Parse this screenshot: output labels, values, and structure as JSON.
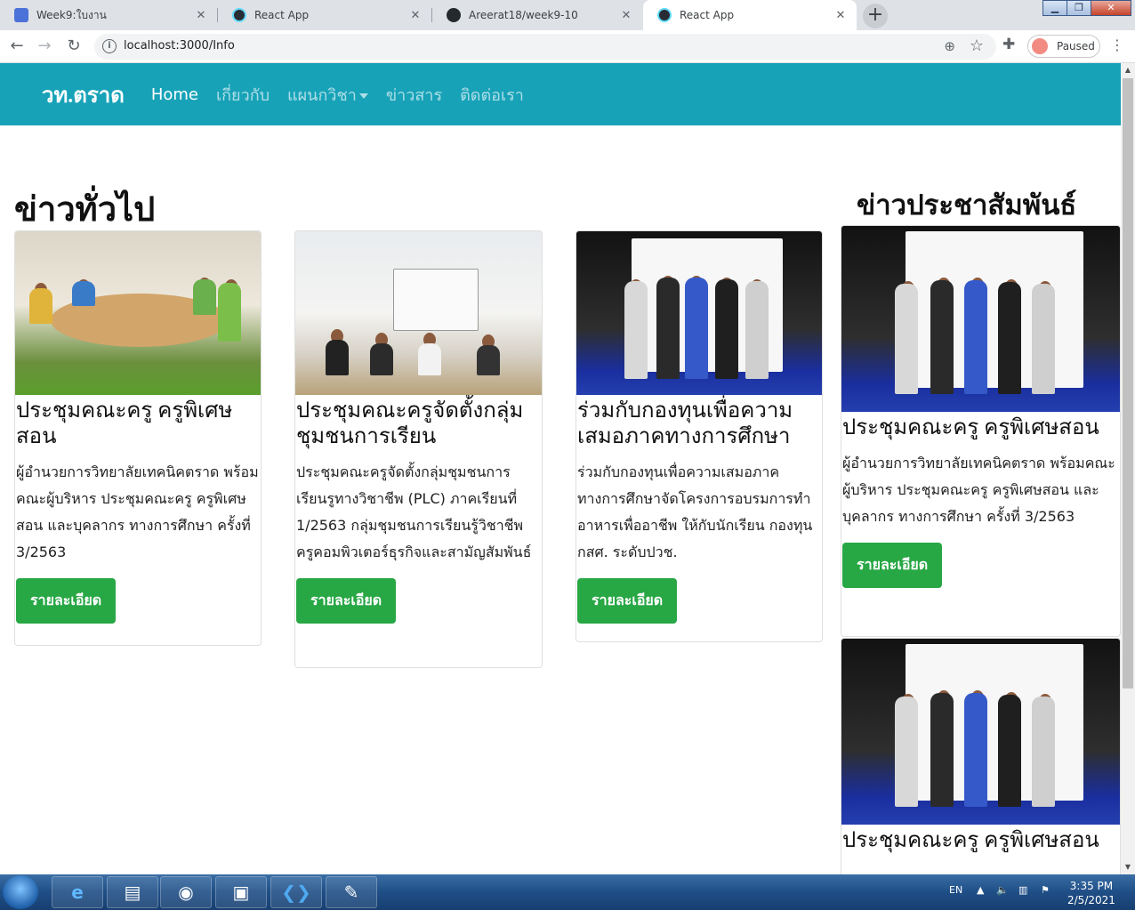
{
  "browser": {
    "tabs": [
      {
        "title": "Week9:ใบงาน",
        "icon": "bookmark-icon",
        "active": false
      },
      {
        "title": "React App",
        "icon": "react-icon",
        "active": false
      },
      {
        "title": "Areerat18/week9-10",
        "icon": "github-icon",
        "active": false
      },
      {
        "title": "React App",
        "icon": "react-icon",
        "active": true
      }
    ],
    "url": "localhost:3000/Info",
    "profile_label": "Paused"
  },
  "navbar": {
    "brand": "วท.ตราด",
    "links": [
      "Home",
      "เกี่ยวกับ",
      "แผนกวิชา",
      "ข่าวสาร",
      "ติดต่อเรา"
    ]
  },
  "sections": {
    "general_heading": "ข่าวทั่วไป",
    "pr_heading": "ข่าวประชาสัมพันธ์"
  },
  "cards": [
    {
      "title": "ประชุมคณะครู ครูพิเศษสอน",
      "text": "ผู้อำนวยการวิทยาลัยเทคนิคตราด พร้อมคณะผู้บริหาร ประชุมคณะครู ครูพิเศษสอน และบุคลากร ทางการศึกษา ครั้งที่ 3/2563",
      "button": "รายละเอียด"
    },
    {
      "title": "ประชุมคณะครูจัดตั้งกลุ่มชุมชนการเรียน",
      "text": "ประชุมคณะครูจัดตั้งกลุ่มชุมชนการเรียนรูทางวิชาชีพ (PLC) ภาคเรียนที่ 1/2563 กลุ่มชุมชนการเรียนรู้วิชาชีพ ครูคอมพิวเตอร์ธุรกิจและสามัญสัมพันธ์",
      "button": "รายละเอียด"
    },
    {
      "title": "ร่วมกับกองทุนเพื่อความเสมอภาคทางการศึกษา",
      "text": "ร่วมกับกองทุนเพื่อความเสมอภาคทางการศึกษาจัดโครงการอบรมการทำอาหารเพื่ออาชีพ ให้กับนักเรียน กองทุน กสศ. ระดับปวช.",
      "button": "รายละเอียด"
    }
  ],
  "pr_cards": [
    {
      "title": "ประชุมคณะครู ครูพิเศษสอน",
      "text": "ผู้อำนวยการวิทยาลัยเทคนิคตราด พร้อมคณะผู้บริหาร ประชุมคณะครู ครูพิเศษสอน และบุคลากร ทางการศึกษา ครั้งที่ 3/2563",
      "button": "รายละเอียด"
    },
    {
      "title": "ประชุมคณะครู ครูพิเศษสอน"
    }
  ],
  "taskbar": {
    "language": "EN",
    "time": "3:35 PM",
    "date": "2/5/2021"
  }
}
